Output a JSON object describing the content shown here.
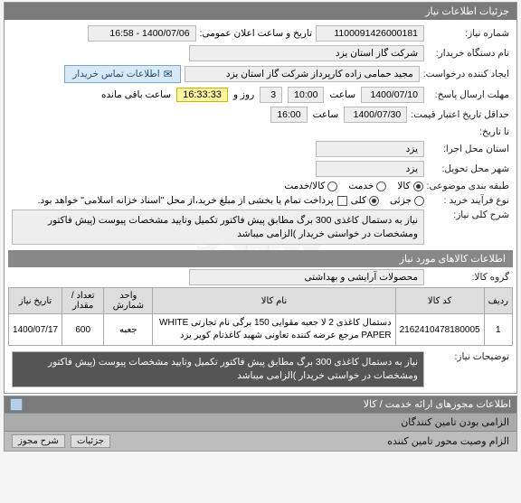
{
  "panel1_title": "جزئیات اطلاعات نیاز",
  "fields": {
    "need_no_label": "شماره نیاز:",
    "need_no": "1100091426000181",
    "announce_label": "تاریخ و ساعت اعلان عمومی:",
    "announce_value": "1400/07/06 - 16:58",
    "buyer_label": "نام دستگاه خریدار:",
    "buyer_value": "شرکت گاز استان یزد",
    "creator_label": "ایجاد کننده درخواست:",
    "creator_value": "مجید حمامی زاده کارپرداز شرکت گاز استان یزد",
    "send_deadline_label": "مهلت ارسال پاسخ:",
    "date1": "1400/07/10",
    "time1_label": "ساعت",
    "time1": "10:00",
    "days_label": "روز و",
    "days": "3",
    "remain_label": "ساعت باقی مانده",
    "remain": "16:33:33",
    "price_valid_label": "حداقل تاریخ اعتبار قیمت:",
    "date2": "1400/07/30",
    "time2_label": "ساعت",
    "time2": "16:00",
    "empty_label": "تا تاریخ:",
    "exec_province_label": "استان محل اجرا:",
    "exec_province": "یزد",
    "deliver_city_label": "شهر محل تحویل:",
    "deliver_city": "یزد",
    "category_label": "طبقه بندی موضوعی:",
    "cat_goods": "کالا",
    "cat_service": "خدمت",
    "cat_both": "کالا/خدمت",
    "proc_type_label": "نوع فرآیند خرید :",
    "proc_partial": "جزئی",
    "proc_total": "کلی",
    "proc_note": "پرداخت تمام یا بخشی از مبلغ خرید،از محل \"اسناد خزانه اسلامی\" خواهد بود.",
    "desc_label": "شرح کلی نیاز:",
    "desc_value": "نیاز به دستمال کاغذی 300 برگ مطابق پیش فاکتور تکمیل وتایید مشخصات پیوست (پیش فاکتور ومشخصات در خواستی خریدار )الزامی میباشد",
    "group_label": "گروه کالا:",
    "group_value": "محصولات آرایشی و بهداشتی",
    "explain_label": "توضیحات نیاز:",
    "explain_value": "نیاز به دستمال کاغذی 300 برگ مطابق پیش فاکتور تکمیل وتایید مشخصات پیوست (پیش فاکتور ومشخصات در خواستی خریدار )الزامی میباشد"
  },
  "contact_btn": "اطلاعات تماس خریدار",
  "sub1": "اطلاعات کالاهای مورد نیاز",
  "table": {
    "headers": [
      "ردیف",
      "کد کالا",
      "نام کالا",
      "واحد شمارش",
      "تعداد / مقدار",
      "تاریخ نیاز"
    ],
    "rows": [
      {
        "idx": "1",
        "code": "2162410478180005",
        "name": "دستمال کاغذی 2 لا جعبه مقوایی 150 برگی نام تجارتی WHITE PAPER مرجع عرضه کننده تعاونی شهید کاغذنام کویر یزد",
        "unit": "جعبه",
        "qty": "600",
        "date": "1400/07/17"
      }
    ]
  },
  "sub2": "اطلاعات مجوزهای ارائه خدمت / کالا",
  "sub3": "الزامی بودن تامین کنندگان",
  "footer_label": "الزام وصیت محور تامین کننده",
  "footer_empty": "جزئیات",
  "footer_btn": "شرح مجوز"
}
